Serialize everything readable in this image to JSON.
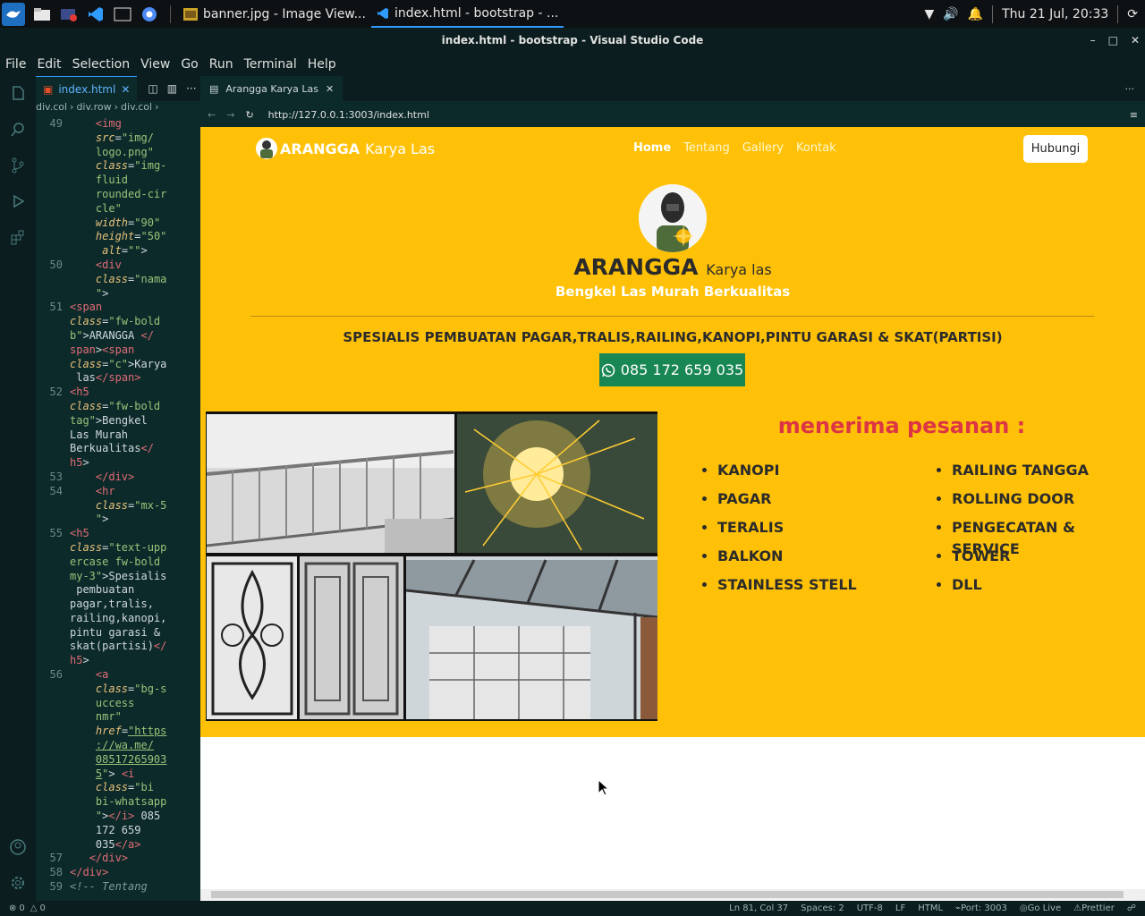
{
  "taskbar": {
    "tasks": [
      {
        "label": "banner.jpg - Image View..."
      },
      {
        "label": "index.html - bootstrap - ..."
      }
    ],
    "clock": "Thu 21 Jul, 20:33"
  },
  "window": {
    "title": "index.html - bootstrap - Visual Studio Code"
  },
  "menu": [
    "File",
    "Edit",
    "Selection",
    "View",
    "Go",
    "Run",
    "Terminal",
    "Help"
  ],
  "editor": {
    "tab": "index.html",
    "breadcrumb": [
      "div.col",
      "div.row",
      "div.col"
    ],
    "line_numbers": [
      "49",
      "50",
      "51",
      "52",
      "53",
      "54",
      "55",
      "56",
      "57",
      "58",
      "59"
    ]
  },
  "browser": {
    "tab": "Arangga Karya Las",
    "url": "http://127.0.0.1:3003/index.html"
  },
  "site": {
    "brand_bold": "ARANGGA",
    "brand_light": "Karya Las",
    "nav": [
      "Home",
      "Tentang",
      "Gallery",
      "Kontak"
    ],
    "cta": "Hubungi",
    "hero_name": "ARANGGA",
    "hero_sub": "Karya las",
    "tagline": "Bengkel Las Murah Berkualitas",
    "specialty": "Spesialis pembuatan pagar,tralis,railing,kanopi,pintu garasi & skat(partisi)",
    "whatsapp": "085 172 659 035",
    "orders_title": "menerima pesanan :",
    "orders_left": [
      "KANOPI",
      "PAGAR",
      "TERALIS",
      "BALKON",
      "STAINLESS STELL"
    ],
    "orders_right": [
      "RAILING TANGGA",
      "ROLLING DOOR",
      "PENGECATAN & SERVICE",
      "TOWER",
      "DLL"
    ]
  },
  "statusbar": {
    "errors": "0",
    "warnings": "0",
    "position": "Ln 81, Col 37",
    "spaces": "Spaces: 2",
    "encoding": "UTF-8",
    "eol": "LF",
    "language": "HTML",
    "port": "Port: 3003",
    "golive": "Go Live",
    "prettier": "Prettier"
  },
  "colors": {
    "accent_yellow": "#ffc107",
    "whatsapp_green": "#198754",
    "orders_red": "#dc3545",
    "editor_bg": "#0d2a2a"
  }
}
